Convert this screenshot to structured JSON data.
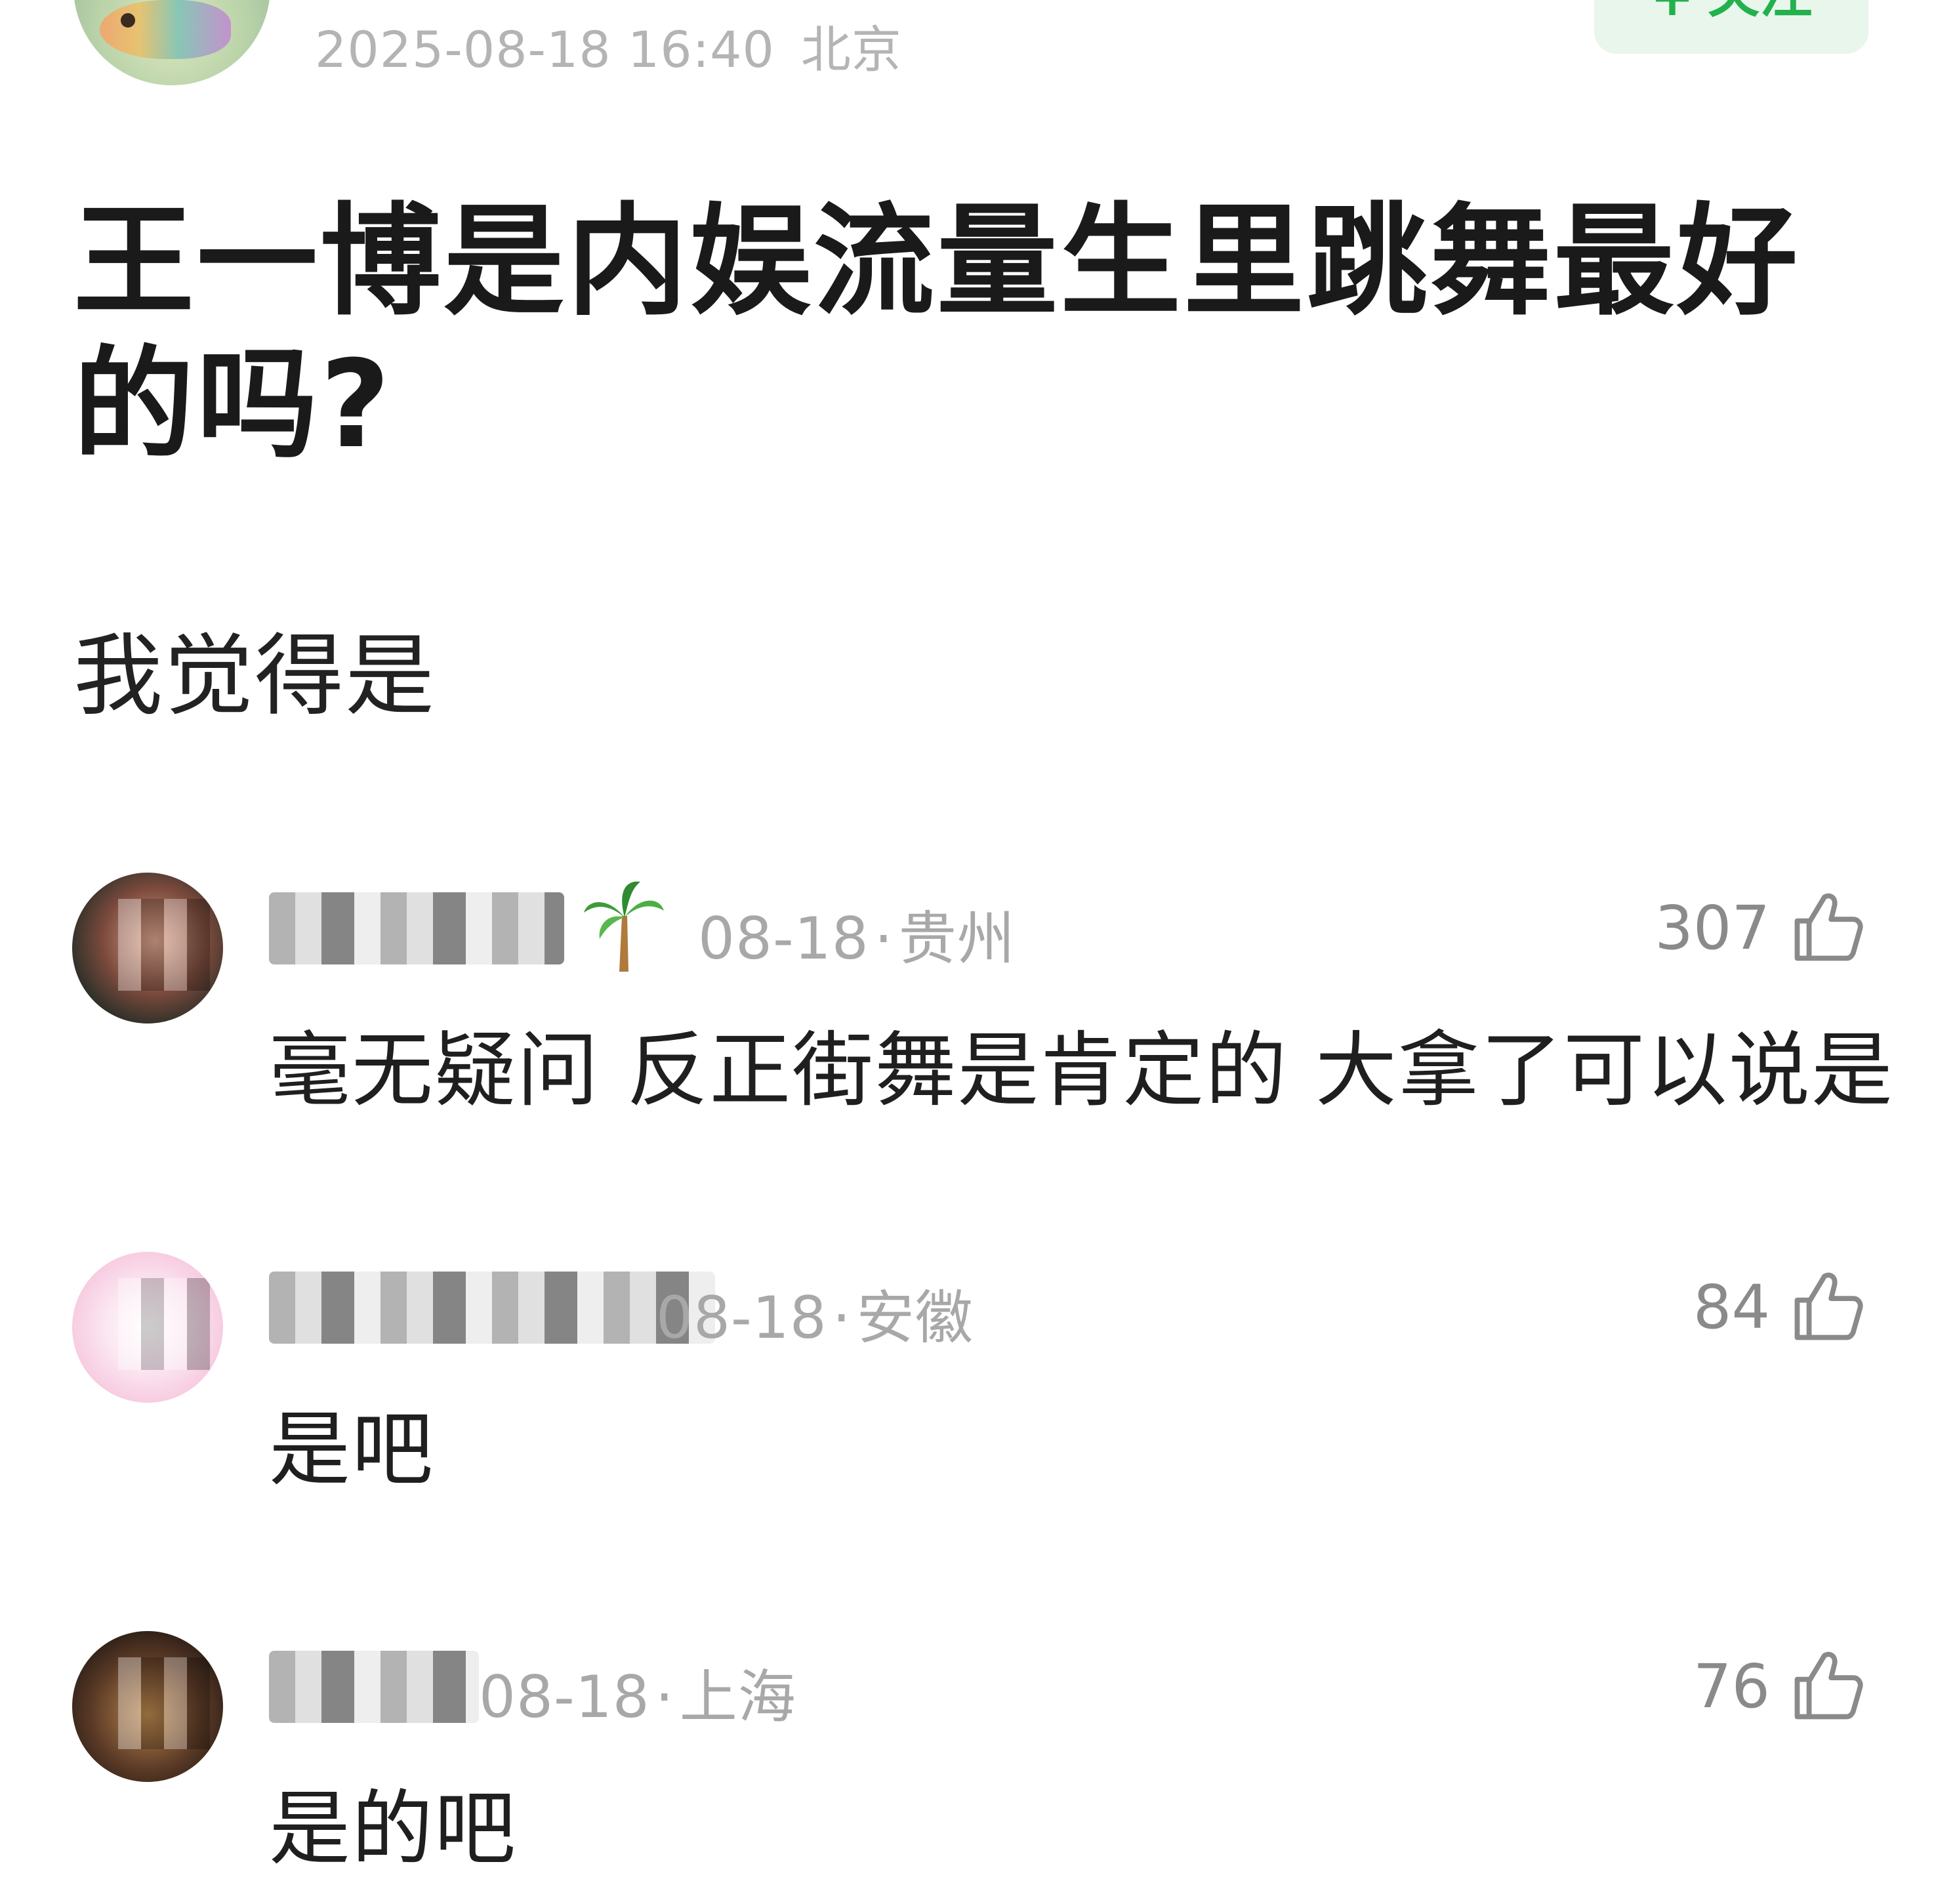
{
  "post": {
    "timestamp": "2025-08-18 16:40",
    "location": "北京",
    "follow_label": "关注",
    "follow_plus": "+",
    "title": "王一博是内娱流量生里跳舞最好的吗?",
    "content": "我觉得是"
  },
  "comments": [
    {
      "date": "08-18",
      "location": "贵州",
      "likes": "307",
      "text": "毫无疑问 反正街舞是肯定的 大拿了可以说是"
    },
    {
      "date": "08-18",
      "location": "安徽",
      "likes": "84",
      "text": "是吧"
    },
    {
      "date": "08-18",
      "location": "上海",
      "likes": "76",
      "text": "是的吧"
    }
  ],
  "colors": {
    "accent_green": "#22b14c",
    "follow_bg": "#e8f6ec",
    "meta_gray": "#a8a8a8"
  },
  "icons": [
    "fish-avatar",
    "palm-tree-icon",
    "thumbs-up-icon"
  ]
}
